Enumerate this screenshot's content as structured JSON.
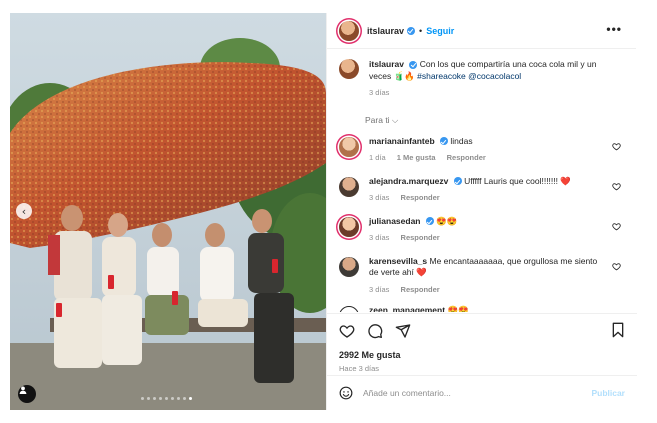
{
  "post": {
    "username": "itslaurav",
    "follow_label": "Seguir",
    "more_label": "•••",
    "separator": "•"
  },
  "caption": {
    "username": "itslaurav",
    "text": "Con los que compartiría una coca cola mil y un veces 🧃🔥",
    "hashtag": "#shareacoke",
    "mention": "@cocacolacol",
    "time": "3 días"
  },
  "sort_label": "Para ti ⌵",
  "comments": [
    {
      "username": "marianainfanteb",
      "verified": true,
      "text": "lindas",
      "time": "1 día",
      "likes": "1 Me gusta",
      "reply": "Responder"
    },
    {
      "username": "alejandra.marquezv",
      "verified": true,
      "text": "Ufffff Lauris que cool!!!!!!! ❤️",
      "time": "3 días",
      "reply": "Responder"
    },
    {
      "username": "julianasedan",
      "verified": true,
      "text": "😍😍",
      "time": "3 días",
      "reply": "Responder"
    },
    {
      "username": "karensevilla_s",
      "verified": false,
      "text": "Me encantaaaaaaa, que orgullosa me siento de verte ahí ❤️",
      "time": "3 días",
      "reply": "Responder"
    },
    {
      "username": "zeen_management",
      "verified": false,
      "text": "😍😍",
      "time": "",
      "reply": ""
    }
  ],
  "likes_label": "2992 Me gusta",
  "posted_ago": "Hace 3 días",
  "comment_input": {
    "placeholder": "Añade un comentario...",
    "value": ""
  },
  "publish_label": "Publicar",
  "carousel": {
    "count": 9,
    "active_index": 8,
    "prev_glyph": "‹"
  },
  "colors": {
    "accent": "#0095f6",
    "verified": "#3897f0",
    "sculpture": "#c2542f",
    "sky": "#c4d2da"
  }
}
